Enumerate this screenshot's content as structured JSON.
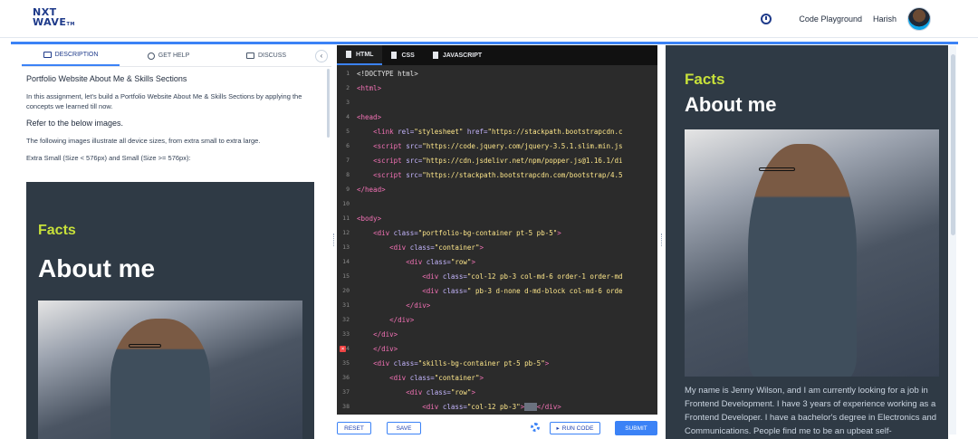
{
  "header": {
    "logo_line1": "NXT",
    "logo_line2": "WAVE",
    "logo_tm": "TM",
    "nav_playground": "Code Playground",
    "user_name": "Harish"
  },
  "left_panel": {
    "tabs": [
      {
        "label": "DESCRIPTION",
        "icon": "document-icon"
      },
      {
        "label": "GET HELP",
        "icon": "help-icon"
      },
      {
        "label": "DISCUSS",
        "icon": "chat-icon"
      }
    ],
    "title": "Portfolio Website About Me & Skills Sections",
    "intro": "In this assignment, let's build a Portfolio Website About Me & Skills Sections by applying the concepts we learned till now.",
    "subheading": "Refer to the below images.",
    "devices_text": "The following images illustrate all device sizes, from extra small to extra large.",
    "size_text": "Extra Small (Size < 576px) and Small (Size >= 576px):",
    "preview_facts": "Facts",
    "preview_about": "About me"
  },
  "editor": {
    "tabs": [
      "HTML",
      "CSS",
      "JAVASCRIPT"
    ],
    "lines": [
      {
        "n": "1",
        "html": "&lt;!DOCTYPE html&gt;"
      },
      {
        "n": "2",
        "html": "<span class='tag'>&lt;html&gt;</span>"
      },
      {
        "n": "3",
        "html": ""
      },
      {
        "n": "4",
        "html": "<span class='tag'>&lt;head&gt;</span>"
      },
      {
        "n": "5",
        "html": "    <span class='tag'>&lt;link</span> <span class='attr'>rel=</span><span class='str'>\"stylesheet\"</span> <span class='attr'>href=</span><span class='str'>\"https://stackpath.bootstrapcdn.c</span>"
      },
      {
        "n": "6",
        "html": "    <span class='tag'>&lt;script</span> <span class='attr'>src=</span><span class='str'>\"https://code.jquery.com/jquery-3.5.1.slim.min.js</span>"
      },
      {
        "n": "7",
        "html": "    <span class='tag'>&lt;script</span> <span class='attr'>src=</span><span class='str'>\"https://cdn.jsdelivr.net/npm/popper.js@1.16.1/di</span>"
      },
      {
        "n": "8",
        "html": "    <span class='tag'>&lt;script</span> <span class='attr'>src=</span><span class='str'>\"https://stackpath.bootstrapcdn.com/bootstrap/4.5</span>"
      },
      {
        "n": "9",
        "html": "<span class='tag'>&lt;/head&gt;</span>"
      },
      {
        "n": "10",
        "html": ""
      },
      {
        "n": "11",
        "html": "<span class='tag'>&lt;body&gt;</span>"
      },
      {
        "n": "12",
        "html": "    <span class='tag'>&lt;div</span> <span class='attr'>class=</span><span class='str'>\"portfolio-bg-container pt-5 pb-5\"</span><span class='tag'>&gt;</span>"
      },
      {
        "n": "13",
        "html": "        <span class='tag'>&lt;div</span> <span class='attr'>class=</span><span class='str'>\"container\"</span><span class='tag'>&gt;</span>"
      },
      {
        "n": "14",
        "html": "            <span class='tag'>&lt;div</span> <span class='attr'>class=</span><span class='str'>\"row\"</span><span class='tag'>&gt;</span>"
      },
      {
        "n": "15",
        "html": "                <span class='tag'>&lt;div</span> <span class='attr'>class=</span><span class='str'>\"col-12 pb-3 col-md-6 order-1 order-md</span>"
      },
      {
        "n": "20",
        "html": "                <span class='tag'>&lt;div</span> <span class='attr'>class=</span><span class='str'>\" pb-3 d-none d-md-block col-md-6 orde</span>"
      },
      {
        "n": "31",
        "html": "            <span class='tag'>&lt;/div&gt;</span>"
      },
      {
        "n": "32",
        "html": "        <span class='tag'>&lt;/div&gt;</span>"
      },
      {
        "n": "33",
        "html": "    <span class='tag'>&lt;/div&gt;</span>"
      },
      {
        "n": "34",
        "html": "    <span class='tag'>&lt;/div&gt;</span>",
        "error": true
      },
      {
        "n": "35",
        "html": "    <span class='tag'>&lt;div</span> <span class='attr'>class=</span><span class='str'>\"skills-bg-container pt-5 pb-5\"</span><span class='tag'>&gt;</span>"
      },
      {
        "n": "36",
        "html": "        <span class='tag'>&lt;div</span> <span class='attr'>class=</span><span class='str'>\"container\"</span><span class='tag'>&gt;</span>"
      },
      {
        "n": "37",
        "html": "            <span class='tag'>&lt;div</span> <span class='attr'>class=</span><span class='str'>\"row\"</span><span class='tag'>&gt;</span>"
      },
      {
        "n": "38",
        "html": "                <span class='tag'>&lt;div</span> <span class='attr'>class=</span><span class='str'>\"col-12 pb-3\"</span><span class='tag'>&gt;</span><span style='background:#6b7280;color:#6b7280'>...</span><span class='tag'>&lt;/div&gt;</span>"
      }
    ]
  },
  "toolbar": {
    "reset": "RESET",
    "save": "SAVE",
    "run": "RUN CODE",
    "submit": "SUBMIT"
  },
  "output": {
    "facts": "Facts",
    "about": "About me",
    "bio": "My name is Jenny Wilson, and I am currently looking for a job in Frontend Development. I have 3 years of experience working as a Frontend Developer. I have a bachelor's degree in Electronics and Communications. People find me to be an upbeat self-"
  },
  "colors": {
    "brand": "#1e3a8a",
    "accent": "#3b82f6",
    "preview_bg": "#2f3a45",
    "facts_green": "#c7e03a",
    "editor_bg": "#2b2b2b"
  }
}
